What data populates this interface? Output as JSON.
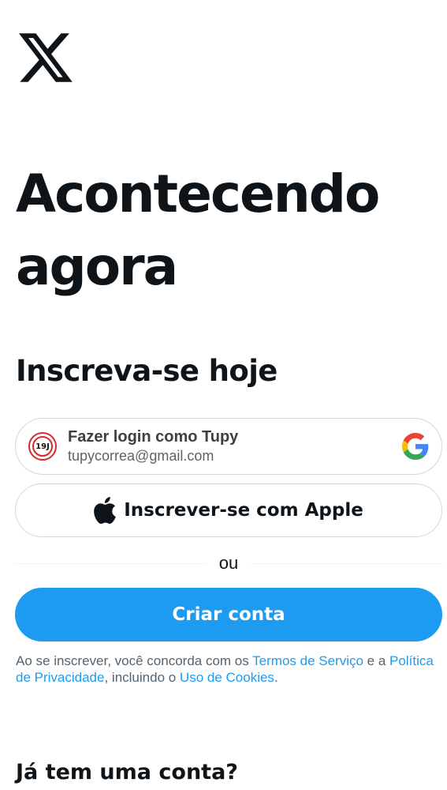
{
  "brand": {
    "logo_icon": "x-logo-icon"
  },
  "hero": {
    "headline_line1": "Acontecendo",
    "headline_line2": "agora",
    "subheading": "Inscreva-se hoje"
  },
  "google_signin": {
    "title": "Fazer login como Tupy",
    "email": "tupycorrea@gmail.com",
    "avatar_text": "19J",
    "avatar_icon": "profile-avatar-icon",
    "brand_icon": "google-g-icon"
  },
  "apple_signin": {
    "label": "Inscrever-se com Apple",
    "icon": "apple-icon"
  },
  "divider": {
    "text": "ou"
  },
  "create_account": {
    "label": "Criar conta"
  },
  "terms": {
    "prefix": "Ao se inscrever, você concorda com os ",
    "terms_link": "Termos de Serviço",
    "mid1": " e a ",
    "privacy_link": "Política de Privacidade",
    "mid2": ", incluindo o ",
    "cookies_link": "Uso de Cookies",
    "suffix": "."
  },
  "login": {
    "heading": "Já tem uma conta?"
  },
  "colors": {
    "accent": "#1d9bf0",
    "text": "#0f1419",
    "muted": "#536471",
    "border": "#cfd9de"
  }
}
